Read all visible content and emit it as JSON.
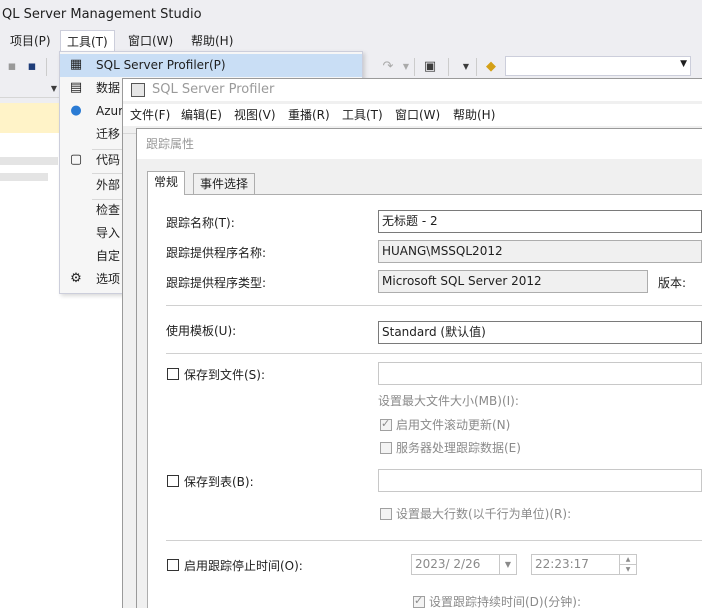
{
  "ssms": {
    "title": "QL Server Management Studio",
    "menu": [
      "项目(P)",
      "工具(T)",
      "窗口(W)",
      "帮助(H)"
    ]
  },
  "tools_menu": {
    "items": [
      {
        "label": "SQL Server Profiler(P)",
        "icon": "profiler-icon"
      },
      {
        "label": "数据",
        "icon": "database-icon"
      },
      {
        "label": "Azur",
        "icon": "azure-icon"
      },
      {
        "label": "迁移",
        "icon": ""
      },
      {
        "label": "代码",
        "icon": "snippet-icon"
      },
      {
        "label": "外部",
        "icon": ""
      },
      {
        "label": "检查",
        "icon": ""
      },
      {
        "label": "导入",
        "icon": ""
      },
      {
        "label": "自定",
        "icon": ""
      },
      {
        "label": "选项",
        "icon": "gear-icon"
      }
    ]
  },
  "profiler": {
    "title": "SQL Server Profiler",
    "menu": [
      "文件(F)",
      "编辑(E)",
      "视图(V)",
      "重播(R)",
      "工具(T)",
      "窗口(W)",
      "帮助(H)"
    ]
  },
  "dialog": {
    "title": "跟踪属性",
    "tabs": [
      "常规",
      "事件选择"
    ],
    "trace_name_label": "跟踪名称(T):",
    "trace_name_value": "无标题 - 2",
    "provider_name_label": "跟踪提供程序名称:",
    "provider_name_value": "HUANG\\MSSQL2012",
    "provider_type_label": "跟踪提供程序类型:",
    "provider_type_value": "Microsoft SQL Server 2012",
    "version_label": "版本:",
    "template_label": "使用模板(U):",
    "template_value": "Standard (默认值)",
    "save_to_file_label": "保存到文件(S):",
    "max_file_size_label": "设置最大文件大小(MB)(I):",
    "file_rollover_label": "启用文件滚动更新(N)",
    "server_processes_label": "服务器处理跟踪数据(E)",
    "save_to_table_label": "保存到表(B):",
    "max_rows_label": "设置最大行数(以千行为单位)(R):",
    "stop_time_label": "启用跟踪停止时间(O):",
    "stop_date_value": "2023/ 2/26",
    "stop_time_value": "22:23:17",
    "duration_label": "设置跟踪持续时间(D)(分钟):"
  }
}
